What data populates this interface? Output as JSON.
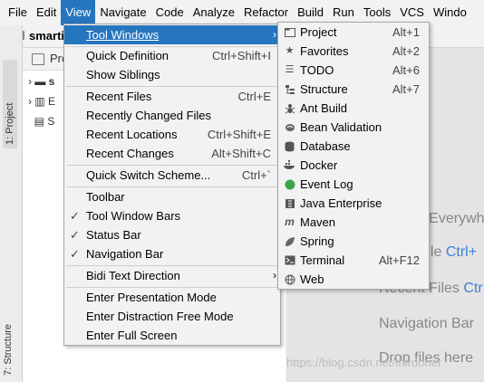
{
  "menubar": {
    "items": [
      "File",
      "Edit",
      "View",
      "Navigate",
      "Code",
      "Analyze",
      "Refactor",
      "Build",
      "Run",
      "Tools",
      "VCS",
      "Windo"
    ]
  },
  "navbar": {
    "breadcrumb": "smarti"
  },
  "left_strip": {
    "project_tab": "1: Project",
    "structure_tab": "7: Structure"
  },
  "project_pane": {
    "header": "Pro",
    "rows": [
      "s",
      "E",
      "S"
    ]
  },
  "editor": {
    "hints": [
      {
        "pre": "Search Everywh",
        "shortcut": ""
      },
      {
        "pre": "Go to File ",
        "shortcut": "Ctrl+"
      },
      {
        "pre": "Recent Files ",
        "shortcut": "Ctr"
      },
      {
        "pre": "Navigation Bar",
        "shortcut": ""
      },
      {
        "pre": "Drop files here",
        "shortcut": ""
      }
    ]
  },
  "view_menu": {
    "items": [
      {
        "label": "Tool Windows",
        "shortcut": "",
        "submenu": true,
        "highlighted": true,
        "checked": false
      },
      {
        "label": "Quick Definition",
        "shortcut": "Ctrl+Shift+I",
        "checked": false
      },
      {
        "label": "Show Siblings",
        "shortcut": "",
        "checked": false
      },
      {
        "label": "Recent Files",
        "shortcut": "Ctrl+E",
        "checked": false
      },
      {
        "label": "Recently Changed Files",
        "shortcut": "",
        "checked": false
      },
      {
        "label": "Recent Locations",
        "shortcut": "Ctrl+Shift+E",
        "checked": false
      },
      {
        "label": "Recent Changes",
        "shortcut": "Alt+Shift+C",
        "checked": false
      },
      {
        "label": "Quick Switch Scheme...",
        "shortcut": "Ctrl+`",
        "checked": false
      },
      {
        "label": "Toolbar",
        "shortcut": "",
        "checked": false
      },
      {
        "label": "Tool Window Bars",
        "shortcut": "",
        "checked": true
      },
      {
        "label": "Status Bar",
        "shortcut": "",
        "checked": true
      },
      {
        "label": "Navigation Bar",
        "shortcut": "",
        "checked": true
      },
      {
        "label": "Bidi Text Direction",
        "shortcut": "",
        "submenu": true,
        "checked": false
      },
      {
        "label": "Enter Presentation Mode",
        "shortcut": "",
        "checked": false
      },
      {
        "label": "Enter Distraction Free Mode",
        "shortcut": "",
        "checked": false
      },
      {
        "label": "Enter Full Screen",
        "shortcut": "",
        "checked": false
      }
    ]
  },
  "tool_windows_menu": {
    "items": [
      {
        "label": "Project",
        "shortcut": "Alt+1",
        "icon": "project-icon"
      },
      {
        "label": "Favorites",
        "shortcut": "Alt+2",
        "icon": "star-icon"
      },
      {
        "label": "TODO",
        "shortcut": "Alt+6",
        "icon": "todo-list-icon"
      },
      {
        "label": "Structure",
        "shortcut": "Alt+7",
        "icon": "structure-icon"
      },
      {
        "label": "Ant Build",
        "shortcut": "",
        "icon": "ant-icon"
      },
      {
        "label": "Bean Validation",
        "shortcut": "",
        "icon": "bean-validation-icon"
      },
      {
        "label": "Database",
        "shortcut": "",
        "icon": "database-icon"
      },
      {
        "label": "Docker",
        "shortcut": "",
        "icon": "docker-icon"
      },
      {
        "label": "Event Log",
        "shortcut": "",
        "icon": "event-log-icon"
      },
      {
        "label": "Java Enterprise",
        "shortcut": "",
        "icon": "java-enterprise-icon"
      },
      {
        "label": "Maven",
        "shortcut": "",
        "icon": "maven-icon"
      },
      {
        "label": "Spring",
        "shortcut": "",
        "icon": "spring-leaf-icon"
      },
      {
        "label": "Terminal",
        "shortcut": "Alt+F12",
        "icon": "terminal-icon"
      },
      {
        "label": "Web",
        "shortcut": "",
        "icon": "globe-icon"
      }
    ]
  },
  "watermark": "https://blog.csdn.net/thirdoner",
  "colors": {
    "highlight": "#2675bf",
    "event_log_green": "#3aa64a"
  }
}
